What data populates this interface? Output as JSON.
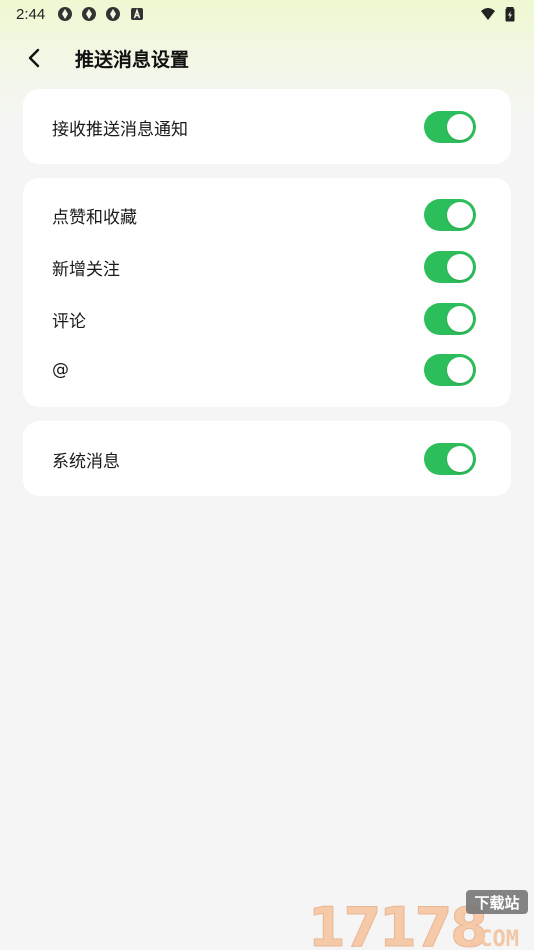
{
  "status_bar": {
    "time": "2:44",
    "left_icons": [
      "aperture-icon",
      "aperture-icon",
      "aperture-icon",
      "a-badge-icon"
    ],
    "right_icons": [
      "wifi-icon",
      "battery-icon"
    ]
  },
  "header": {
    "title": "推送消息设置",
    "back_icon": "chevron-left-icon"
  },
  "sections": [
    {
      "items": [
        {
          "label": "接收推送消息通知",
          "enabled": true
        }
      ]
    },
    {
      "items": [
        {
          "label": "点赞和收藏",
          "enabled": true
        },
        {
          "label": "新增关注",
          "enabled": true
        },
        {
          "label": "评论",
          "enabled": true
        },
        {
          "label": "@",
          "enabled": true
        }
      ]
    },
    {
      "items": [
        {
          "label": "系统消息",
          "enabled": true
        }
      ]
    }
  ],
  "watermark": {
    "brand": "17178",
    "suffix": "下载站",
    "domain": ".COM"
  },
  "colors": {
    "toggle_on": "#2dbe5c",
    "background": "#f5f5f5",
    "header_tint": "#eef8d0"
  }
}
